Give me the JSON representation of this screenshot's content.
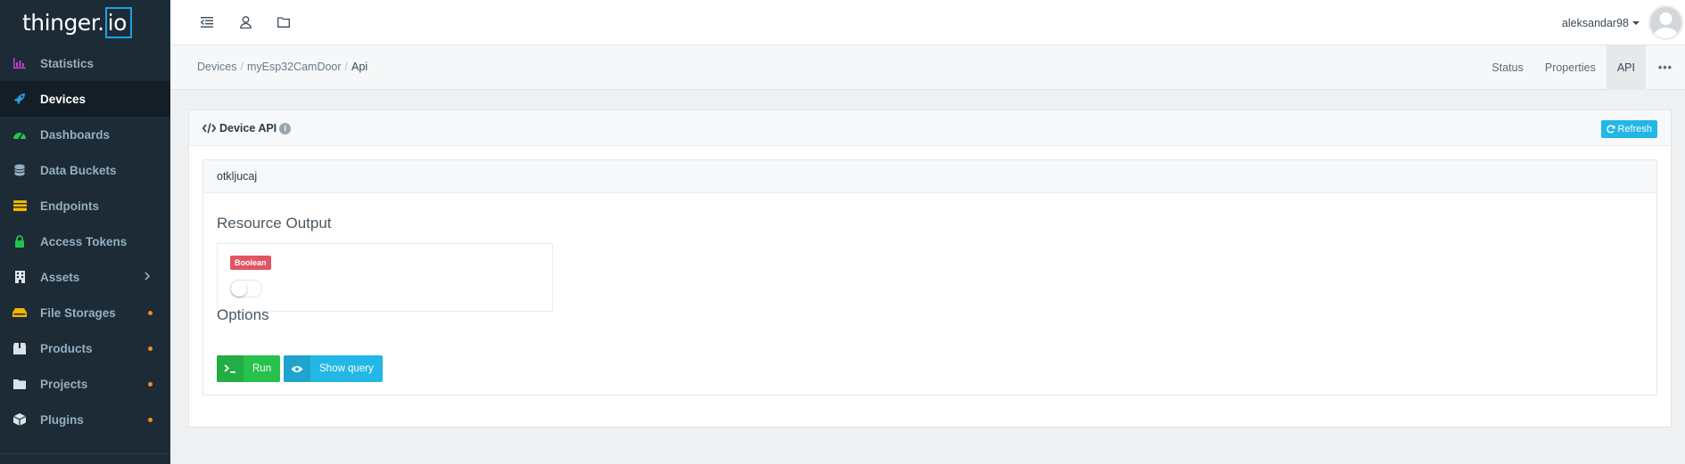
{
  "brand": {
    "logo_text": "thinger.",
    "logo_box": "io"
  },
  "sidebar": {
    "items": [
      {
        "label": "Statistics",
        "icon": "chart-icon",
        "color": "#c640c9"
      },
      {
        "label": "Devices",
        "icon": "rocket-icon",
        "color": "#1da1e6",
        "active": true
      },
      {
        "label": "Dashboards",
        "icon": "dashboard-icon",
        "color": "#27c24c"
      },
      {
        "label": "Data Buckets",
        "icon": "database-icon",
        "color": "#95aec0"
      },
      {
        "label": "Endpoints",
        "icon": "endpoint-icon",
        "color": "#f4b400"
      },
      {
        "label": "Access Tokens",
        "icon": "lock-icon",
        "color": "#27c24c"
      },
      {
        "label": "Assets",
        "icon": "building-icon",
        "color": "#dbe3e8"
      },
      {
        "label": "File Storages",
        "icon": "storage-icon",
        "color": "#f4b400"
      },
      {
        "label": "Products",
        "icon": "box-icon",
        "color": "#dbe3e8"
      },
      {
        "label": "Projects",
        "icon": "folder-icon",
        "color": "#dbe3e8"
      },
      {
        "label": "Plugins",
        "icon": "cube-icon",
        "color": "#dbe3e8"
      }
    ]
  },
  "topbar": {
    "username": "aleksandar98"
  },
  "breadcrumb": {
    "items": [
      "Devices",
      "myEsp32CamDoor",
      "Api"
    ]
  },
  "tabs": [
    "Status",
    "Properties",
    "API",
    "•••"
  ],
  "panel": {
    "title": "Device API",
    "refresh_label": "Refresh",
    "resource": {
      "name": "otkljucaj",
      "output_title": "Resource Output",
      "output_type": "Boolean",
      "toggle_value": false,
      "options_title": "Options",
      "run_label": "Run",
      "query_label": "Show query"
    }
  },
  "colors": {
    "sidebar_bg": "#1c2b36",
    "accent_blue": "#23b7e5",
    "run_green": "#27c24c",
    "badge_red": "#e05563",
    "notification_dot": "#f58a1f"
  }
}
